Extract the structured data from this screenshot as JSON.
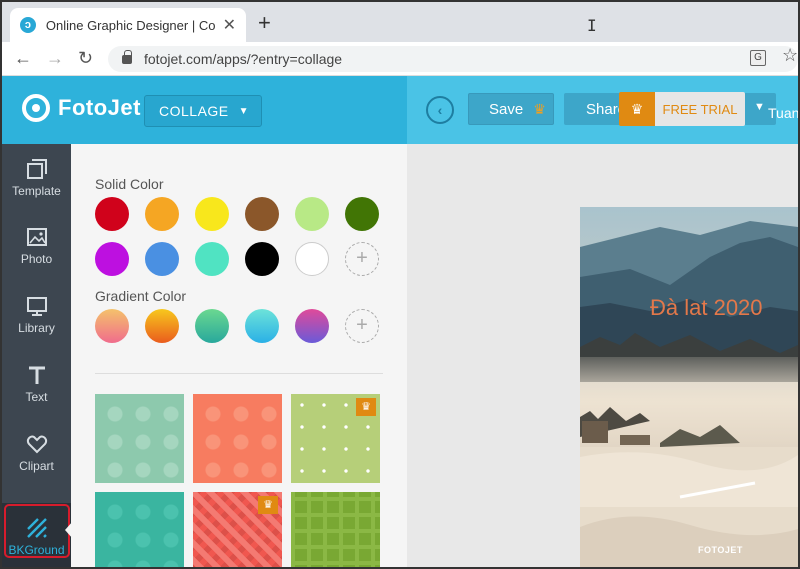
{
  "browser": {
    "tab_title": "Online Graphic Designer | Collage",
    "tab_close": "✕",
    "new_tab": "+",
    "url": "fotojet.com/apps/?entry=collage",
    "back": "←",
    "forward": "→",
    "reload": "↻"
  },
  "header": {
    "logo_text": "FotoJet",
    "mode": "COLLAGE",
    "save_label": "Save",
    "share_label": "Share",
    "trial_label": "FREE TRIAL",
    "user_name": "Tuan"
  },
  "rail": {
    "items": [
      {
        "label": "Template",
        "icon": "template-icon"
      },
      {
        "label": "Photo",
        "icon": "photo-icon"
      },
      {
        "label": "Library",
        "icon": "library-icon"
      },
      {
        "label": "Text",
        "icon": "text-icon"
      },
      {
        "label": "Clipart",
        "icon": "heart-icon"
      },
      {
        "label": "BKGround",
        "icon": "background-icon"
      }
    ],
    "active": "BKGround"
  },
  "panel": {
    "solid_label": "Solid Color",
    "gradient_label": "Gradient Color",
    "add_symbol": "+",
    "solid_colors": [
      "#d0021b",
      "#f5a623",
      "#f8e71c",
      "#8b572a",
      "#b8e986",
      "#417505",
      "#bd10e0",
      "#4a90e2",
      "#50e3c2",
      "#000000",
      "#ffffff"
    ],
    "gradient_colors": [
      [
        "#f4c26b",
        "#f06c8c"
      ],
      [
        "#f7c81d",
        "#ea5c1d"
      ],
      [
        "#6bd890",
        "#28a89c"
      ],
      [
        "#6de3d9",
        "#2ab0e6"
      ],
      [
        "#e04a9a",
        "#6a5ad8"
      ]
    ],
    "patterns": [
      {
        "kind": "polka",
        "bg": "#8dc9ad",
        "dot": "#a5d6bf",
        "premium": false
      },
      {
        "kind": "polka",
        "bg": "#f77c60",
        "dot": "#f99479",
        "premium": false
      },
      {
        "kind": "sparse-dots",
        "bg": "#b6cf79",
        "dot": "#ffffff",
        "premium": true
      },
      {
        "kind": "polka",
        "bg": "#3ab5a0",
        "dot": "#4bc2ae",
        "premium": false
      },
      {
        "kind": "weave",
        "bg": "#f0574f",
        "dot": "#f47a72",
        "premium": true
      },
      {
        "kind": "plaid",
        "bg": "#79a833",
        "dot": "#8bb845",
        "premium": false
      }
    ]
  },
  "canvas": {
    "photo_title": "Đà lat 2020",
    "watermark": "FOTOJET"
  },
  "colors": {
    "brand": "#2eb2db",
    "rail": "#3d4650",
    "highlight": "#d71c2c",
    "premium": "#e08a12"
  }
}
